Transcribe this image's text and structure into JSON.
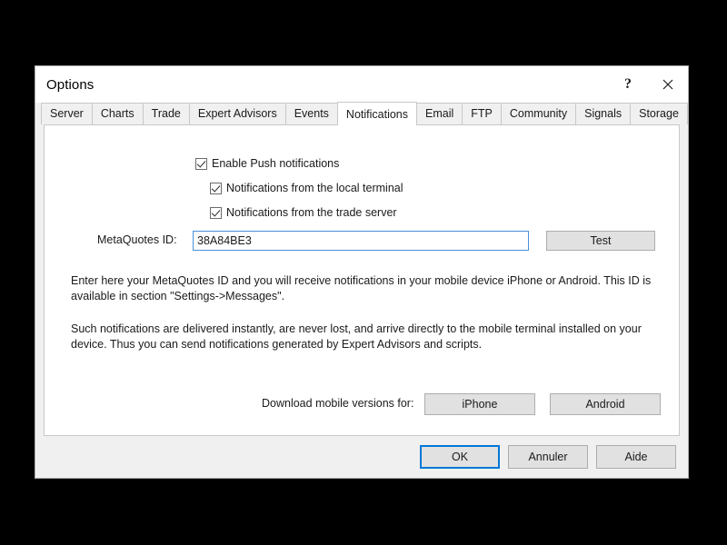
{
  "window": {
    "title": "Options",
    "help_button": "?",
    "close_button": "✕"
  },
  "tabs": [
    {
      "label": "Server",
      "active": false
    },
    {
      "label": "Charts",
      "active": false
    },
    {
      "label": "Trade",
      "active": false
    },
    {
      "label": "Expert Advisors",
      "active": false
    },
    {
      "label": "Events",
      "active": false
    },
    {
      "label": "Notifications",
      "active": true
    },
    {
      "label": "Email",
      "active": false
    },
    {
      "label": "FTP",
      "active": false
    },
    {
      "label": "Community",
      "active": false
    },
    {
      "label": "Signals",
      "active": false
    },
    {
      "label": "Storage",
      "active": false
    }
  ],
  "notifications": {
    "checkboxes": [
      {
        "label": "Enable Push notifications",
        "checked": true
      },
      {
        "label": "Notifications from the local terminal",
        "checked": true
      },
      {
        "label": "Notifications from the trade server",
        "checked": true
      }
    ],
    "metaquotes": {
      "label": "MetaQuotes ID:",
      "value": "38A84BE3",
      "placeholder": "",
      "test_button": "Test"
    },
    "paragraph_1": "Enter here your MetaQuotes ID and you will receive notifications in your mobile device iPhone or Android. This ID is available in section \"Settings->Messages\".",
    "paragraph_2": "Such notifications are delivered instantly, are never lost, and arrive directly to the mobile terminal installed on your device. Thus you can send notifications generated by Expert Advisors and scripts.",
    "download": {
      "label": "Download mobile versions for:",
      "iphone_button": "iPhone",
      "android_button": "Android"
    }
  },
  "footer": {
    "ok": "OK",
    "cancel": "Annuler",
    "help": "Aide"
  },
  "colors": {
    "accent": "#0078d7",
    "field_border": "#4a90d9",
    "dialog_bg": "#f0f0f0",
    "page_bg": "#ffffff",
    "button_bg": "#e1e1e1",
    "text": "#1a1a1a",
    "backdrop": "#000000"
  }
}
